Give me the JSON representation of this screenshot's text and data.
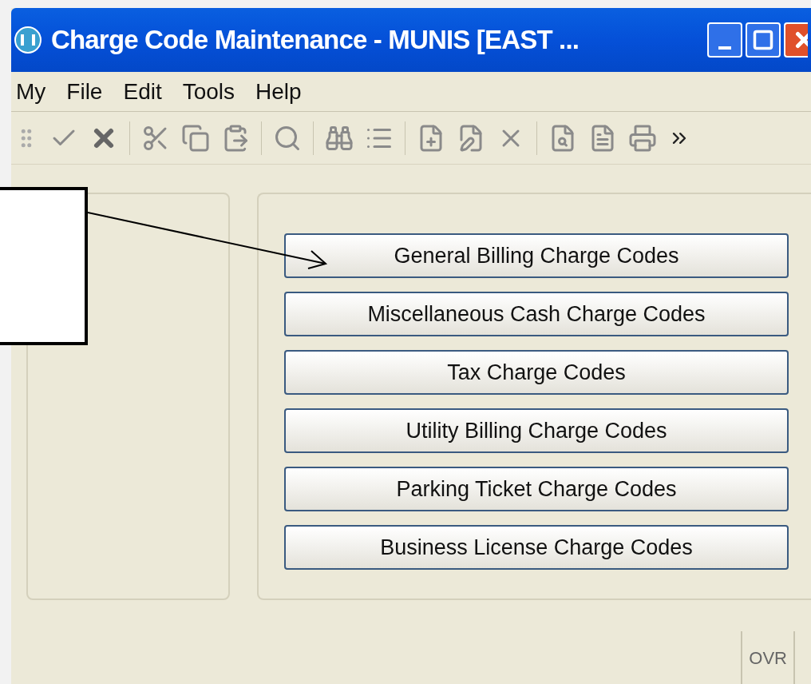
{
  "window": {
    "title": "Charge Code Maintenance - MUNIS [EAST ..."
  },
  "menu": [
    "My",
    "File",
    "Edit",
    "Tools",
    "Help"
  ],
  "buttons": [
    "General Billing Charge Codes",
    "Miscellaneous Cash Charge Codes",
    "Tax Charge Codes",
    "Utility Billing Charge Codes",
    "Parking Ticket Charge Codes",
    "Business License Charge Codes"
  ],
  "status_bar": {
    "mode": "OVR"
  }
}
